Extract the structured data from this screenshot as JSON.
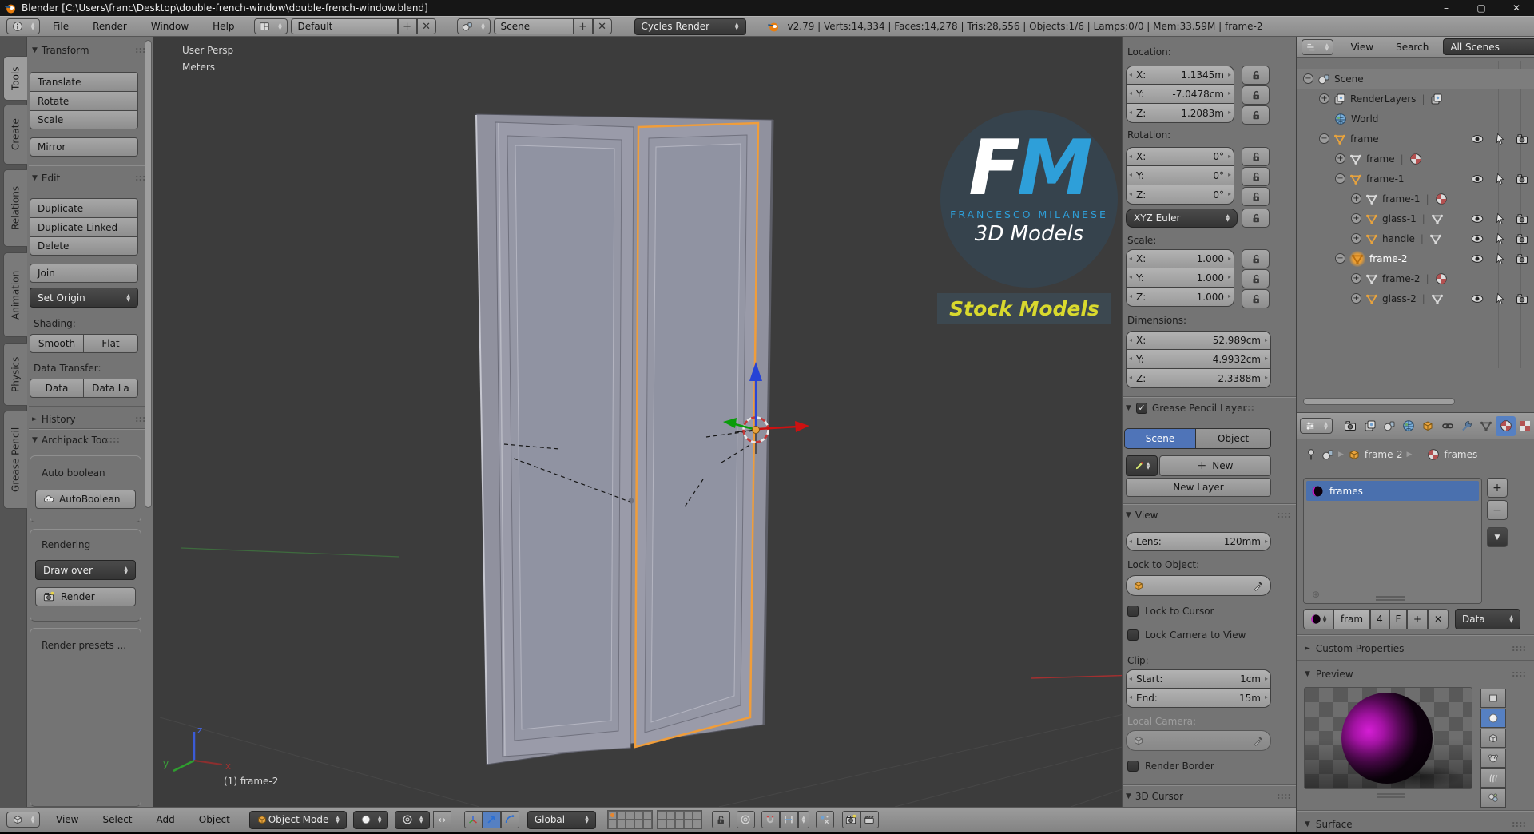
{
  "titlebar": {
    "title": "Blender [C:\\Users\\franc\\Desktop\\double-french-window\\double-french-window.blend]"
  },
  "infobar": {
    "menus": [
      {
        "label": "File"
      },
      {
        "label": "Render"
      },
      {
        "label": "Window"
      },
      {
        "label": "Help"
      }
    ],
    "layout_value": "Default",
    "scene_value": "Scene",
    "engine_value": "Cycles Render",
    "stats": "v2.79 | Verts:14,334 | Faces:14,278 | Tris:28,556 | Objects:1/6 | Lamps:0/0 | Mem:33.59M | frame-2"
  },
  "tool_tabs": [
    {
      "label": "Tools"
    },
    {
      "label": "Create"
    },
    {
      "label": "Relations"
    },
    {
      "label": "Animation"
    },
    {
      "label": "Physics"
    },
    {
      "label": "Grease Pencil"
    }
  ],
  "tool_shelf": {
    "transform_title": "Transform",
    "translate": "Translate",
    "rotate": "Rotate",
    "scale": "Scale",
    "mirror": "Mirror",
    "edit_title": "Edit",
    "duplicate": "Duplicate",
    "duplicate_linked": "Duplicate Linked",
    "delete": "Delete",
    "join": "Join",
    "set_origin": "Set Origin",
    "shading_label": "Shading:",
    "smooth": "Smooth",
    "flat": "Flat",
    "data_transfer_label": "Data Transfer:",
    "data": "Data",
    "data_layout": "Data La",
    "history_title": "History",
    "archipack_title": "Archipack Too",
    "auto_boolean_label": "Auto boolean",
    "autoboolean_button": "AutoBoolean",
    "rendering_label": "Rendering",
    "draw_over": "Draw over",
    "render_button": "Render",
    "render_presets": "Render presets ..."
  },
  "viewport": {
    "view_label": "User Persp",
    "units_label": "Meters",
    "active_object_label": "(1) frame-2",
    "axis_x": "x",
    "axis_y": "y",
    "axis_z": "z",
    "watermark": {
      "initial_f": "F",
      "initial_m": "M",
      "name": "FRANCESCO MILANESE",
      "tagline": "3D Models",
      "banner": "Stock Models",
      "accent_blue": "#2e9fd9",
      "banner_yellow": "#d9d92e"
    }
  },
  "npanel": {
    "location_label": "Location:",
    "loc_x_label": "X:",
    "loc_x": "1.1345m",
    "loc_y_label": "Y:",
    "loc_y": "-7.0478cm",
    "loc_z_label": "Z:",
    "loc_z": "1.2083m",
    "rotation_label": "Rotation:",
    "rot_x_label": "X:",
    "rot_x": "0°",
    "rot_y_label": "Y:",
    "rot_y": "0°",
    "rot_z_label": "Z:",
    "rot_z": "0°",
    "euler_mode": "XYZ Euler",
    "scale_label": "Scale:",
    "scl_x_label": "X:",
    "scl_x": "1.000",
    "scl_y_label": "Y:",
    "scl_y": "1.000",
    "scl_z_label": "Z:",
    "scl_z": "1.000",
    "dimensions_label": "Dimensions:",
    "dim_x_label": "X:",
    "dim_x": "52.989cm",
    "dim_y_label": "Y:",
    "dim_y": "4.9932cm",
    "dim_z_label": "Z:",
    "dim_z": "2.3388m",
    "gp_title": "Grease Pencil Layer",
    "gp_scene": "Scene",
    "gp_object": "Object",
    "gp_new": "New",
    "gp_new_layer": "New Layer",
    "view_title": "View",
    "lens_label": "Lens:",
    "lens_value": "120mm",
    "lock_to_object_label": "Lock to Object:",
    "lock_to_cursor": "Lock to Cursor",
    "lock_camera": "Lock Camera to View",
    "clip_label": "Clip:",
    "clip_start_label": "Start:",
    "clip_start": "1cm",
    "clip_end_label": "End:",
    "clip_end": "15m",
    "local_camera_label": "Local Camera:",
    "render_border": "Render Border",
    "cursor_title": "3D Cursor"
  },
  "outliner": {
    "view_menu": "View",
    "search_menu": "Search",
    "display_mode": "All Scenes",
    "tree": [
      {
        "label": "Scene"
      },
      {
        "label": "RenderLayers"
      },
      {
        "label": "World"
      },
      {
        "label": "frame"
      },
      {
        "label": "frame"
      },
      {
        "label": "frame-1"
      },
      {
        "label": "frame-1"
      },
      {
        "label": "glass-1"
      },
      {
        "label": "handle"
      },
      {
        "label": "frame-2"
      },
      {
        "label": "frame-2"
      },
      {
        "label": "glass-2"
      }
    ]
  },
  "properties": {
    "breadcrumb_object": "frame-2",
    "breadcrumb_material": "frames",
    "material_slot": "frames",
    "name_value": "fram",
    "users_count": "4",
    "fake_user": "F",
    "datablock_type": "Data",
    "custom_properties_title": "Custom Properties",
    "preview_title": "Preview",
    "surface_title": "Surface"
  },
  "v3dheader": {
    "menus": [
      {
        "label": "View"
      },
      {
        "label": "Select"
      },
      {
        "label": "Add"
      },
      {
        "label": "Object"
      }
    ],
    "mode_value": "Object Mode",
    "orientation_value": "Global"
  }
}
